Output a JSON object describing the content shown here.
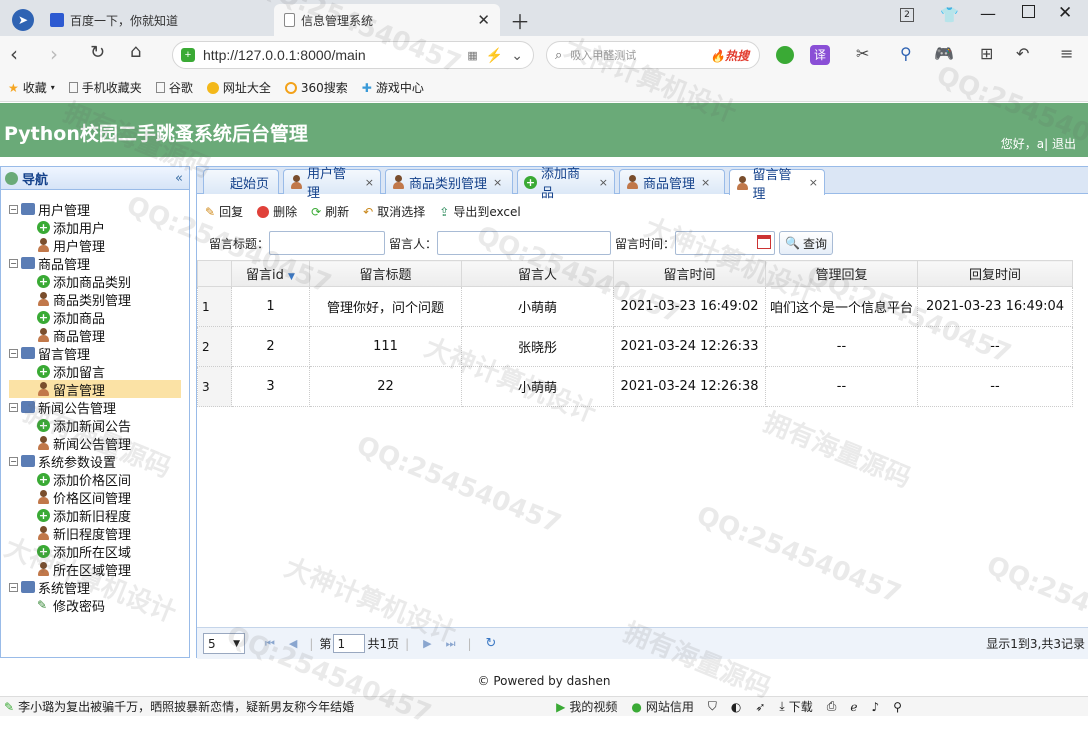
{
  "browser": {
    "tabs": [
      {
        "title": "百度一下，你就知道"
      },
      {
        "title": "信息管理系统"
      }
    ],
    "url": "http://127.0.0.1:8000/main",
    "search_placeholder": "吸入甲醛测试",
    "hot_label": "热搜",
    "translate_label": "译",
    "bookmarks": [
      {
        "label": "收藏"
      },
      {
        "label": "手机收藏夹"
      },
      {
        "label": "谷歌"
      },
      {
        "label": "网址大全"
      },
      {
        "label": "360搜索"
      },
      {
        "label": "游戏中心"
      }
    ]
  },
  "app": {
    "title": "Python校园二手跳蚤系统后台管理",
    "greeting": "您好，a| 退出"
  },
  "sidebar": {
    "title": "导航",
    "groups": [
      {
        "label": "用户管理",
        "items": [
          {
            "label": "添加用户",
            "icon": "add"
          },
          {
            "label": "用户管理",
            "icon": "user"
          }
        ]
      },
      {
        "label": "商品管理",
        "items": [
          {
            "label": "添加商品类别",
            "icon": "add"
          },
          {
            "label": "商品类别管理",
            "icon": "user"
          },
          {
            "label": "添加商品",
            "icon": "add"
          },
          {
            "label": "商品管理",
            "icon": "user"
          }
        ]
      },
      {
        "label": "留言管理",
        "items": [
          {
            "label": "添加留言",
            "icon": "add"
          },
          {
            "label": "留言管理",
            "icon": "user"
          }
        ]
      },
      {
        "label": "新闻公告管理",
        "items": [
          {
            "label": "添加新闻公告",
            "icon": "add"
          },
          {
            "label": "新闻公告管理",
            "icon": "user"
          }
        ]
      },
      {
        "label": "系统参数设置",
        "items": [
          {
            "label": "添加价格区间",
            "icon": "add"
          },
          {
            "label": "价格区间管理",
            "icon": "user"
          },
          {
            "label": "添加新旧程度",
            "icon": "add"
          },
          {
            "label": "新旧程度管理",
            "icon": "user"
          },
          {
            "label": "添加所在区域",
            "icon": "add"
          },
          {
            "label": "所在区域管理",
            "icon": "user"
          }
        ]
      },
      {
        "label": "系统管理",
        "items": [
          {
            "label": "修改密码",
            "icon": "pen"
          }
        ]
      }
    ],
    "selected": "留言管理"
  },
  "main": {
    "tabs": [
      {
        "label": "起始页",
        "icon": "none",
        "closable": false
      },
      {
        "label": "用户管理",
        "icon": "user",
        "closable": true
      },
      {
        "label": "商品类别管理",
        "icon": "user",
        "closable": true
      },
      {
        "label": "添加商品",
        "icon": "add",
        "closable": true
      },
      {
        "label": "商品管理",
        "icon": "user",
        "closable": true
      },
      {
        "label": "留言管理",
        "icon": "user",
        "closable": true
      }
    ],
    "toolbar": {
      "reply": "回复",
      "delete": "删除",
      "refresh": "刷新",
      "clear": "取消选择",
      "export": "导出到excel"
    },
    "filters": {
      "title_label": "留言标题：",
      "person_label": "留言人：",
      "time_label": "留言时间：",
      "query": "查询"
    },
    "grid": {
      "columns": [
        "留言id",
        "留言标题",
        "留言人",
        "留言时间",
        "管理回复",
        "回复时间"
      ],
      "rows": [
        {
          "rn": "1",
          "cells": [
            "1",
            "管理你好，问个问题",
            "小萌萌",
            "2021-03-23 16:49:02",
            "咱们这个是一个信息平台",
            "2021-03-23 16:49:04"
          ]
        },
        {
          "rn": "2",
          "cells": [
            "2",
            "111",
            "张晓彤",
            "2021-03-24 12:26:33",
            "--",
            "--"
          ]
        },
        {
          "rn": "3",
          "cells": [
            "3",
            "22",
            "小萌萌",
            "2021-03-24 12:26:38",
            "--",
            "--"
          ]
        }
      ]
    },
    "pager": {
      "page_size": "5",
      "page_prefix": "第",
      "page_value": "1",
      "page_suffix": "共1页",
      "info": "显示1到3,共3记录"
    }
  },
  "footer": {
    "text": "© Powered by dashen"
  },
  "statusbar": {
    "news": "李小璐为复出被骗千万，晒照披暴新恋情，疑新男友称今年结婚",
    "video": "我的视频",
    "credit": "网站信用",
    "download": "下载"
  },
  "watermarks": [
    "QQ:254540457",
    "大神计算机设计",
    "拥有海量源码"
  ],
  "colors": {
    "header": "#6aaa78",
    "panel_border": "#99bbe8",
    "selected_row": "#fbe2a5"
  }
}
